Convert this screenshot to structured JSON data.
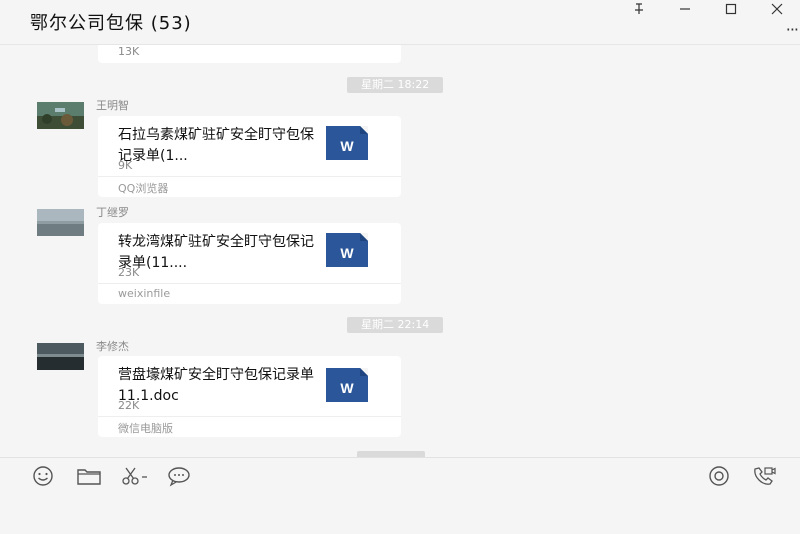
{
  "window": {
    "title": "鄂尔公司包保 (53)",
    "controls": {
      "pin": "ꟸ",
      "minimize": "—",
      "maximize": "☐",
      "close": "✕",
      "more": "···"
    }
  },
  "messages": [
    {
      "size": "13K"
    },
    {
      "time": "星期二 18:22"
    },
    {
      "sender": "王明智",
      "file_name": "石拉乌素煤矿驻矿安全盯守包保记录单(1...",
      "size": "9K",
      "source": "QQ浏览器",
      "file_icon": "W"
    },
    {
      "sender": "丁继罗",
      "file_name": "转龙湾煤矿驻矿安全盯守包保记录单(11....",
      "size": "23K",
      "source": "weixinfile",
      "file_icon": "W"
    },
    {
      "time": "星期二 22:14"
    },
    {
      "sender": "李修杰",
      "file_name": "营盘壕煤矿安全盯守包保记录单11.1.doc",
      "size": "22K",
      "source": "微信电脑版",
      "file_icon": "W"
    }
  ],
  "toolbar": {
    "left": [
      "emoji-icon",
      "folder-icon",
      "scissors-icon",
      "chat-bubble-icon"
    ],
    "right": [
      "live-icon",
      "video-call-icon"
    ]
  },
  "colors": {
    "word_blue": "#2b579a",
    "time_badge": "#dadada",
    "bubble": "#ffffff",
    "background": "#f5f5f5"
  }
}
